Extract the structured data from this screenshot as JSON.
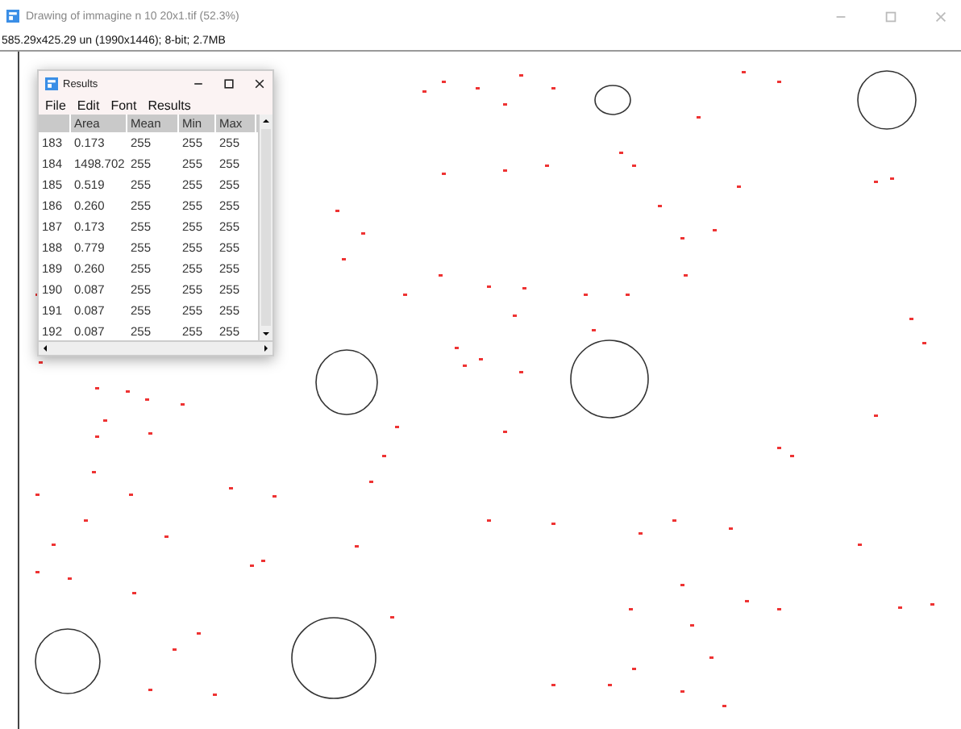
{
  "window": {
    "title": "Drawing of immagine n 10 20x1.tif (52.3%)"
  },
  "status_line": "585.29x425.29 un (1990x1446); 8-bit; 2.7MB",
  "results_window": {
    "title": "Results",
    "menu": [
      "File",
      "Edit",
      "Font",
      "Results"
    ],
    "columns": [
      "",
      "Area",
      "Mean",
      "Min",
      "Max"
    ],
    "rows": [
      [
        "183",
        "0.173",
        "255",
        "255",
        "255"
      ],
      [
        "184",
        "1498.702",
        "255",
        "255",
        "255"
      ],
      [
        "185",
        "0.519",
        "255",
        "255",
        "255"
      ],
      [
        "186",
        "0.260",
        "255",
        "255",
        "255"
      ],
      [
        "187",
        "0.173",
        "255",
        "255",
        "255"
      ],
      [
        "188",
        "0.779",
        "255",
        "255",
        "255"
      ],
      [
        "189",
        "0.260",
        "255",
        "255",
        "255"
      ],
      [
        "190",
        "0.087",
        "255",
        "255",
        "255"
      ],
      [
        "191",
        "0.087",
        "255",
        "255",
        "255"
      ],
      [
        "192",
        "0.087",
        "255",
        "255",
        "255"
      ]
    ]
  }
}
